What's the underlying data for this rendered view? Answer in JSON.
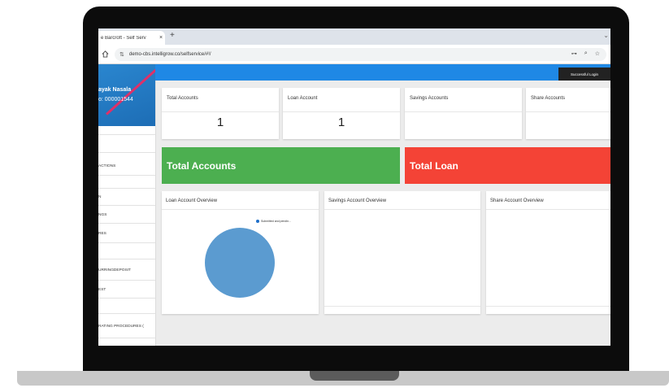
{
  "browser": {
    "tab_title": "e Barcroft - Self Serv",
    "tab_close": "×",
    "new_tab": "+",
    "tab_menu": "⌄",
    "url": "demo-cbs.intelligrow.co/selfservice/#!/"
  },
  "sidebar": {
    "user_name": "ayak Nasala",
    "user_number": "o: 000001544",
    "items": [
      {
        "label": ""
      },
      {
        "label": ""
      },
      {
        "label": "ACTIONS"
      },
      {
        "label": ""
      },
      {
        "label": "N"
      },
      {
        "label": "NGS"
      },
      {
        "label": "RES"
      },
      {
        "label": ""
      },
      {
        "label": "URRINGDEPOSIT"
      },
      {
        "label": "EST"
      },
      {
        "label": ""
      },
      {
        "label": "RATING PROCEDURES ("
      }
    ]
  },
  "topbar": {
    "toast": "Successful Login"
  },
  "stats": [
    {
      "label": "Total Accounts",
      "value": "1"
    },
    {
      "label": "Loan Account",
      "value": "1"
    },
    {
      "label": "Savings Accounts",
      "value": ""
    },
    {
      "label": "Share Accounts",
      "value": ""
    }
  ],
  "banners": {
    "total_accounts": "Total Accounts",
    "total_loan": "Total Loan"
  },
  "panels": {
    "loan_overview": "Loan Account Overview",
    "savings_overview": "Savings Account Overview",
    "share_overview": "Share Account Overview"
  },
  "chart_data": {
    "type": "pie",
    "title": "",
    "labels": [
      "Submitted and pendin..."
    ],
    "values": [
      1
    ],
    "colors": [
      "#5b9bd0"
    ],
    "legend_placement": "top-right"
  },
  "colors": {
    "topbar": "#1f88e5",
    "banner_green": "#4caf50",
    "banner_red": "#f44336",
    "legend_dot": "#1e6fc9"
  }
}
